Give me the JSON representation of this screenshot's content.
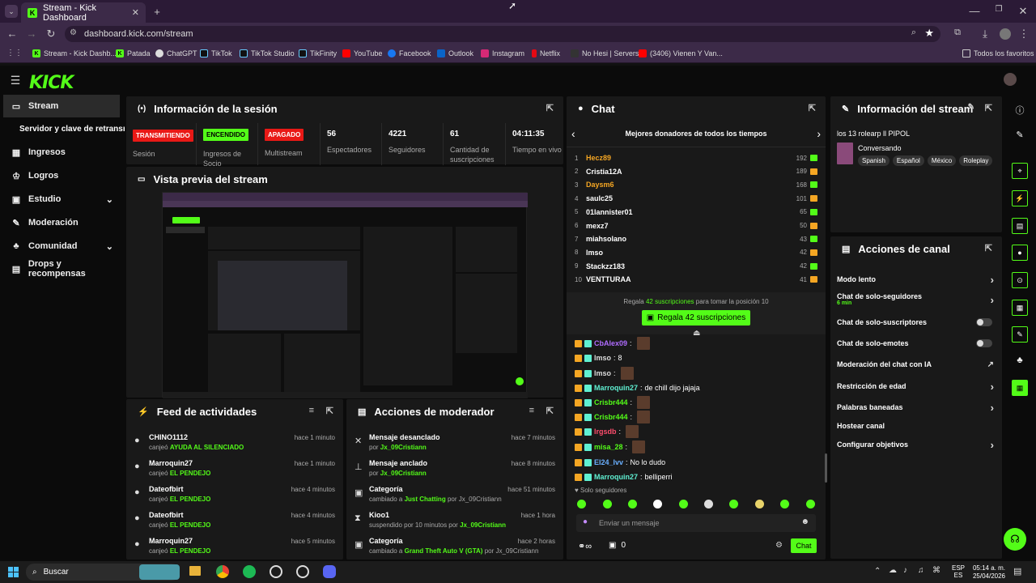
{
  "browser": {
    "tab_title": "Stream - Kick Dashboard",
    "url": "dashboard.kick.com/stream",
    "bookmarks": [
      "Stream - Kick Dashb...",
      "Patada",
      "ChatGPT",
      "TikTok",
      "TikTok Studio",
      "TikFinity",
      "YouTube",
      "Facebook",
      "Outlook",
      "Instagram",
      "Netflix",
      "No Hesi | Servers",
      "(3406) Vienen Y Van..."
    ],
    "all_bookmarks": "Todos los favoritos"
  },
  "sidebar": {
    "items": [
      "Stream",
      "Servidor y clave de retransmisión",
      "Ingresos",
      "Logros",
      "Estudio",
      "Moderación",
      "Comunidad",
      "Drops y recompensas"
    ]
  },
  "session": {
    "title": "Información de la sesión",
    "badges": [
      {
        "text": "TRANSMITIENDO",
        "label": "Sesión"
      },
      {
        "text": "ENCENDIDO",
        "label": "Ingresos de Socio"
      },
      {
        "text": "APAGADO",
        "label": "Multistream"
      }
    ],
    "stats": [
      {
        "v": "56",
        "l": "Espectadores"
      },
      {
        "v": "4221",
        "l": "Seguidores"
      },
      {
        "v": "61",
        "l": "Cantidad de suscripciones"
      },
      {
        "v": "04:11:35",
        "l": "Tiempo en vivo"
      }
    ]
  },
  "preview": {
    "title": "Vista previa del stream"
  },
  "activity": {
    "title": "Feed de actividades",
    "items": [
      {
        "n": "CHINO1112",
        "a": "canjeó",
        "r": "AYUDA AL SILENCIADO",
        "t": "hace 1 minuto"
      },
      {
        "n": "Marroquin27",
        "a": "canjeó",
        "r": "EL PENDEJO",
        "t": "hace 1 minuto"
      },
      {
        "n": "Dateofbirt",
        "a": "canjeó",
        "r": "EL PENDEJO",
        "t": "hace 4 minutos"
      },
      {
        "n": "Dateofbirt",
        "a": "canjeó",
        "r": "EL PENDEJO",
        "t": "hace 4 minutos"
      },
      {
        "n": "Marroquin27",
        "a": "canjeó",
        "r": "EL PENDEJO",
        "t": "hace 5 minutos"
      }
    ]
  },
  "modactions": {
    "title": "Acciones de moderador",
    "items": [
      {
        "n": "Mensaje desanclado",
        "d": "por",
        "u": "Jx_09Cristiann",
        "x": "",
        "t": "hace 7 minutos"
      },
      {
        "n": "Mensaje anclado",
        "d": "por",
        "u": "Jx_09Cristiann",
        "x": "",
        "t": "hace 8 minutos"
      },
      {
        "n": "Categoría",
        "d": "cambiado a",
        "u": "Just Chatting",
        "x": "por Jx_09Cristiann",
        "t": "hace 51 minutos"
      },
      {
        "n": "Kioo1",
        "d": "suspendido por 10 minutos por",
        "u": "Jx_09Cristiann",
        "x": "",
        "t": "hace 1 hora"
      },
      {
        "n": "Categoría",
        "d": "cambiado a",
        "u": "Grand Theft Auto V (GTA)",
        "x": "por Jx_09Cristiann",
        "t": "hace 2 horas"
      }
    ]
  },
  "chat": {
    "title": "Chat",
    "donors_title": "Mejores donadores de todos los tiempos",
    "donors": [
      {
        "r": "1",
        "n": "Hecz89",
        "c": "192",
        "color": "#f5a623"
      },
      {
        "r": "2",
        "n": "Cristia12A",
        "c": "189",
        "color": "#ffffff"
      },
      {
        "r": "3",
        "n": "Daysm6",
        "c": "168",
        "color": "#f5a623"
      },
      {
        "r": "4",
        "n": "saulc25",
        "c": "101",
        "color": "#ffffff"
      },
      {
        "r": "5",
        "n": "01lannister01",
        "c": "65",
        "color": "#ffffff"
      },
      {
        "r": "6",
        "n": "mexz7",
        "c": "50",
        "color": "#ffffff"
      },
      {
        "r": "7",
        "n": "miahsolano",
        "c": "43",
        "color": "#ffffff"
      },
      {
        "r": "8",
        "n": "lmso",
        "c": "42",
        "color": "#ffffff"
      },
      {
        "r": "9",
        "n": "Stackzz183",
        "c": "42",
        "color": "#ffffff"
      },
      {
        "r": "10",
        "n": "VENTTURAA",
        "c": "41",
        "color": "#ffffff"
      }
    ],
    "gift_pre": "Regala",
    "gift_subs": "42 suscripciones",
    "gift_post": "para tomar la posición 10",
    "gift_button": "Regala 42 suscripciones",
    "messages": [
      {
        "u": "CbAlex09",
        "m": "",
        "c": "#b06cff"
      },
      {
        "u": "lmso",
        "m": "8",
        "c": "#ddd"
      },
      {
        "u": "lmso",
        "m": "",
        "c": "#ddd"
      },
      {
        "u": "Marroquin27",
        "m": "de chill dijo jajaja",
        "c": "#5ff0d2"
      },
      {
        "u": "Crisbr444",
        "m": "",
        "c": "#53fc18"
      },
      {
        "u": "Crisbr444",
        "m": "",
        "c": "#53fc18"
      },
      {
        "u": "lrgsdb",
        "m": "",
        "c": "#ff4d6d"
      },
      {
        "u": "misa_28",
        "m": "",
        "c": "#53fc18"
      },
      {
        "u": "El24_lvv",
        "m": "No lo dudo",
        "c": "#6ab0ff"
      },
      {
        "u": "Marroquin27",
        "m": "belliperri",
        "c": "#5ff0d2"
      }
    ],
    "followers_only": "Solo seguidores",
    "placeholder": "Enviar un mensaje",
    "count": "0",
    "send": "Chat"
  },
  "streaminfo": {
    "title": "Información del stream",
    "stream_title": "los 13 rolearp ll PIPOL",
    "category": "Conversando",
    "tags": [
      "Spanish",
      "Español",
      "México",
      "Roleplay"
    ]
  },
  "channel": {
    "title": "Acciones de canal",
    "items": [
      "Modo lento",
      "Chat de solo-seguidores",
      "Chat de solo-suscriptores",
      "Chat de solo-emotes",
      "Moderación del chat con IA",
      "Restricción de edad",
      "Palabras baneadas",
      "Hostear canal",
      "Configurar objetivos"
    ],
    "followers_sub": "6 min"
  },
  "taskbar": {
    "search": "Buscar",
    "lang1": "ESP",
    "lang2": "ES",
    "time": "05:14 a. m.",
    "date": "25/04/2026"
  },
  "colors": {
    "green": "#53fc18",
    "red": "#e91916",
    "panel": "#191919"
  }
}
